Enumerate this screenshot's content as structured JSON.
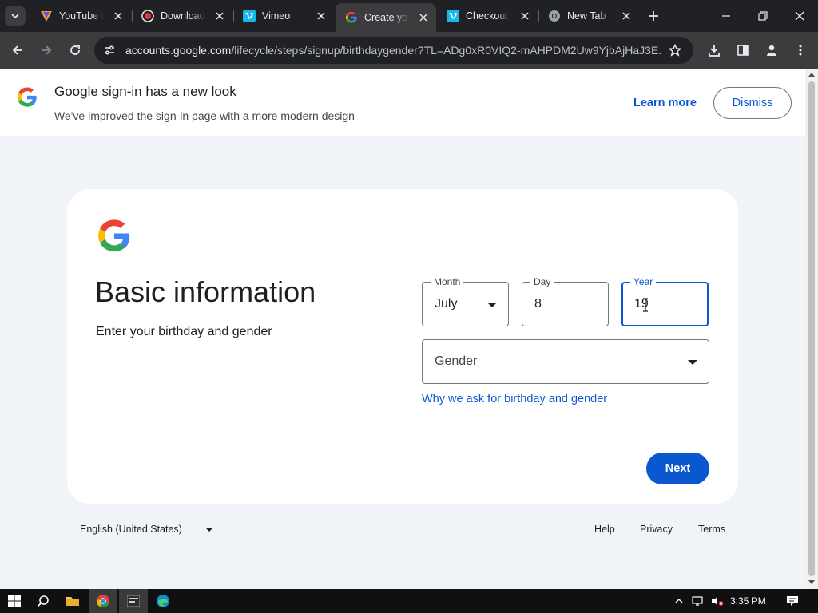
{
  "browser": {
    "tabs": [
      {
        "title": "YouTube to",
        "icon": "youtube-converter-icon",
        "active": false
      },
      {
        "title": "Download",
        "icon": "record-icon",
        "active": false
      },
      {
        "title": "Vimeo",
        "icon": "vimeo-icon",
        "active": false
      },
      {
        "title": "Create your",
        "icon": "google-icon",
        "active": true
      },
      {
        "title": "Checkout",
        "icon": "vimeo-icon",
        "active": false
      },
      {
        "title": "New Tab",
        "icon": "chrome-icon",
        "active": false
      }
    ],
    "url_host": "accounts.google.com",
    "url_path": "/lifecycle/steps/signup/birthdaygender?TL=ADg0xR0VIQ2-mAHPDM2Uw9YjbAjHaJ3E..."
  },
  "banner": {
    "title": "Google sign-in has a new look",
    "subtitle": "We've improved the sign-in page with a more modern design",
    "learn_more": "Learn more",
    "dismiss": "Dismiss"
  },
  "form": {
    "heading": "Basic information",
    "subheading": "Enter your birthday and gender",
    "month": {
      "label": "Month",
      "value": "July"
    },
    "day": {
      "label": "Day",
      "value": "8"
    },
    "year": {
      "label": "Year",
      "value": "19"
    },
    "gender": {
      "placeholder": "Gender"
    },
    "why_link": "Why we ask for birthday and gender",
    "next": "Next"
  },
  "footer": {
    "language": "English (United States)",
    "help": "Help",
    "privacy": "Privacy",
    "terms": "Terms"
  },
  "taskbar": {
    "time": "3:35 PM"
  },
  "colors": {
    "accent": "#0b57d0",
    "page_bg": "#f0f4f9",
    "chrome_dark": "#202124",
    "chrome_toolbar": "#3c3c3f"
  }
}
